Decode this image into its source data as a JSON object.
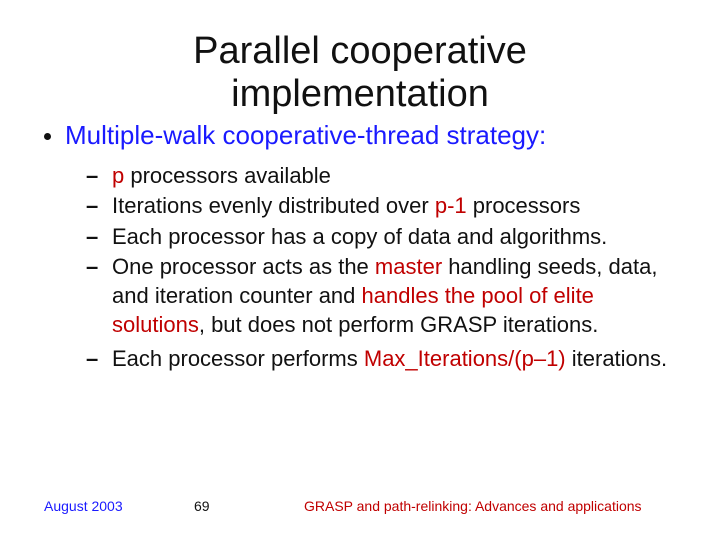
{
  "title_l1": "Parallel cooperative",
  "title_l2": "implementation",
  "main_bullet": "Multiple-walk cooperative-thread strategy:",
  "items": [
    {
      "pre": "",
      "red1": "p",
      "mid": " processors available",
      "red2": "",
      "post": ""
    },
    {
      "pre": "Iterations evenly distributed over ",
      "red1": "p-1",
      "mid": " processors",
      "red2": "",
      "post": ""
    },
    {
      "pre": "Each processor has a copy of data and algorithms.",
      "red1": "",
      "mid": "",
      "red2": "",
      "post": ""
    },
    {
      "pre": "One processor acts as the ",
      "red1": "master",
      "mid": " handling seeds, data, and iteration counter and ",
      "red2": "handles the pool of elite solutions",
      "post": ", but does not perform GRASP iterations."
    },
    {
      "pre": "Each processor performs ",
      "red1": "Max_Iterations/(p–1)",
      "mid": " iterations.",
      "red2": "",
      "post": ""
    }
  ],
  "footer": {
    "date": "August 2003",
    "page": "69",
    "source": "GRASP and path-relinking: Advances and applications"
  }
}
